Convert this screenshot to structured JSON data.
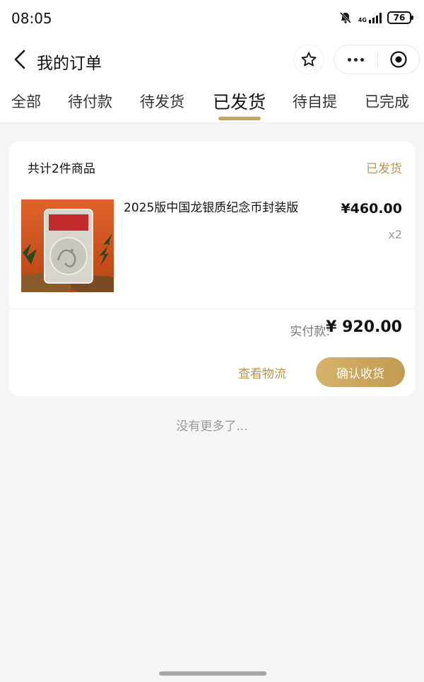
{
  "status_bar": {
    "time": "08:05",
    "network": "4G",
    "battery": "76"
  },
  "nav": {
    "title": "我的订单",
    "icons": [
      "back-arrow-icon",
      "star-icon",
      "more-dots-icon",
      "close-circle-icon"
    ]
  },
  "tabs": [
    {
      "label": "全部",
      "active": false
    },
    {
      "label": "待付款",
      "active": false
    },
    {
      "label": "待发货",
      "active": false
    },
    {
      "label": "已发货",
      "active": true
    },
    {
      "label": "待自提",
      "active": false
    },
    {
      "label": "已完成",
      "active": false
    }
  ],
  "order": {
    "item_count": "共计2件商品",
    "status": "已发货",
    "product": {
      "name": "2025版中国龙银质纪念币封装版",
      "price": "¥460.00",
      "quantity": "x2"
    },
    "paid_label": "实付款:",
    "paid_amount": "¥ 920.00",
    "buttons": {
      "logistics": "查看物流",
      "confirm": "确认收货"
    }
  },
  "footer": {
    "no_more": "没有更多了..."
  },
  "colors": {
    "accent_gold": "#c8a35a",
    "status_gold": "#b8934a",
    "background": "#f5f5f5"
  }
}
